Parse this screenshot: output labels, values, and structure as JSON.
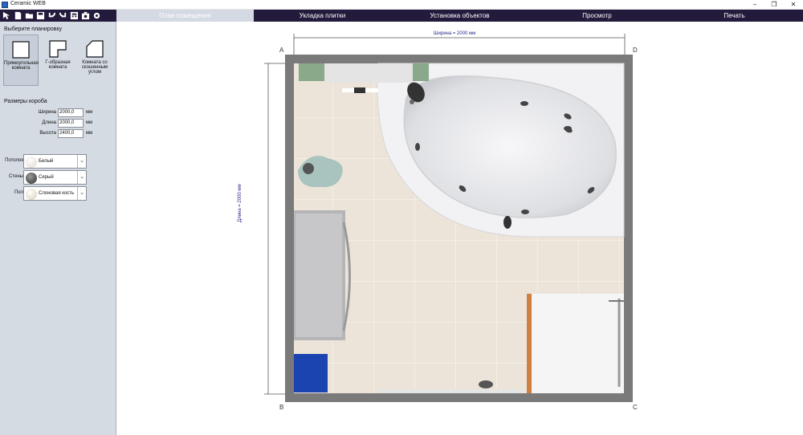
{
  "window": {
    "title": "Ceramic WEB",
    "minimize": "–",
    "restore": "❐",
    "close": "✕"
  },
  "toolbar": {
    "icons": [
      "pointer-icon",
      "new-file-icon",
      "open-folder-icon",
      "save-icon",
      "undo-icon",
      "redo-icon",
      "calculator-icon",
      "screenshot-icon",
      "settings-icon"
    ]
  },
  "tabs": [
    {
      "label": "План помещения",
      "active": true
    },
    {
      "label": "Укладка плитки",
      "active": false
    },
    {
      "label": "Установка объектов",
      "active": false
    },
    {
      "label": "Просмотр",
      "active": false
    },
    {
      "label": "Печать",
      "active": false
    }
  ],
  "left": {
    "choose_layout": "Выберите планировку",
    "layouts": [
      {
        "label": "Прямоугольная комната",
        "selected": true
      },
      {
        "label": "Г-образная комната",
        "selected": false
      },
      {
        "label": "Комната со скошенным углом",
        "selected": false
      }
    ],
    "box_sizes": "Размеры короба",
    "fields": [
      {
        "label": "Ширина",
        "value": "2000,0",
        "unit": "мм"
      },
      {
        "label": "Длина",
        "value": "2000,0",
        "unit": "мм"
      },
      {
        "label": "Высота",
        "value": "2400,0",
        "unit": "мм"
      }
    ],
    "materials": [
      {
        "label": "Потолок",
        "value": "Белый",
        "swatch": "#f4f1ea"
      },
      {
        "label": "Стены",
        "value": "Серый",
        "swatch": "#555555"
      },
      {
        "label": "Пол",
        "value": "Слоновая кость",
        "swatch": "#f1ead8"
      }
    ]
  },
  "plan": {
    "width_label": "Ширина = 2000 мм",
    "length_label": "Длина = 2000 мм",
    "corners": {
      "a": "A",
      "b": "B",
      "c": "C",
      "d": "D"
    }
  }
}
